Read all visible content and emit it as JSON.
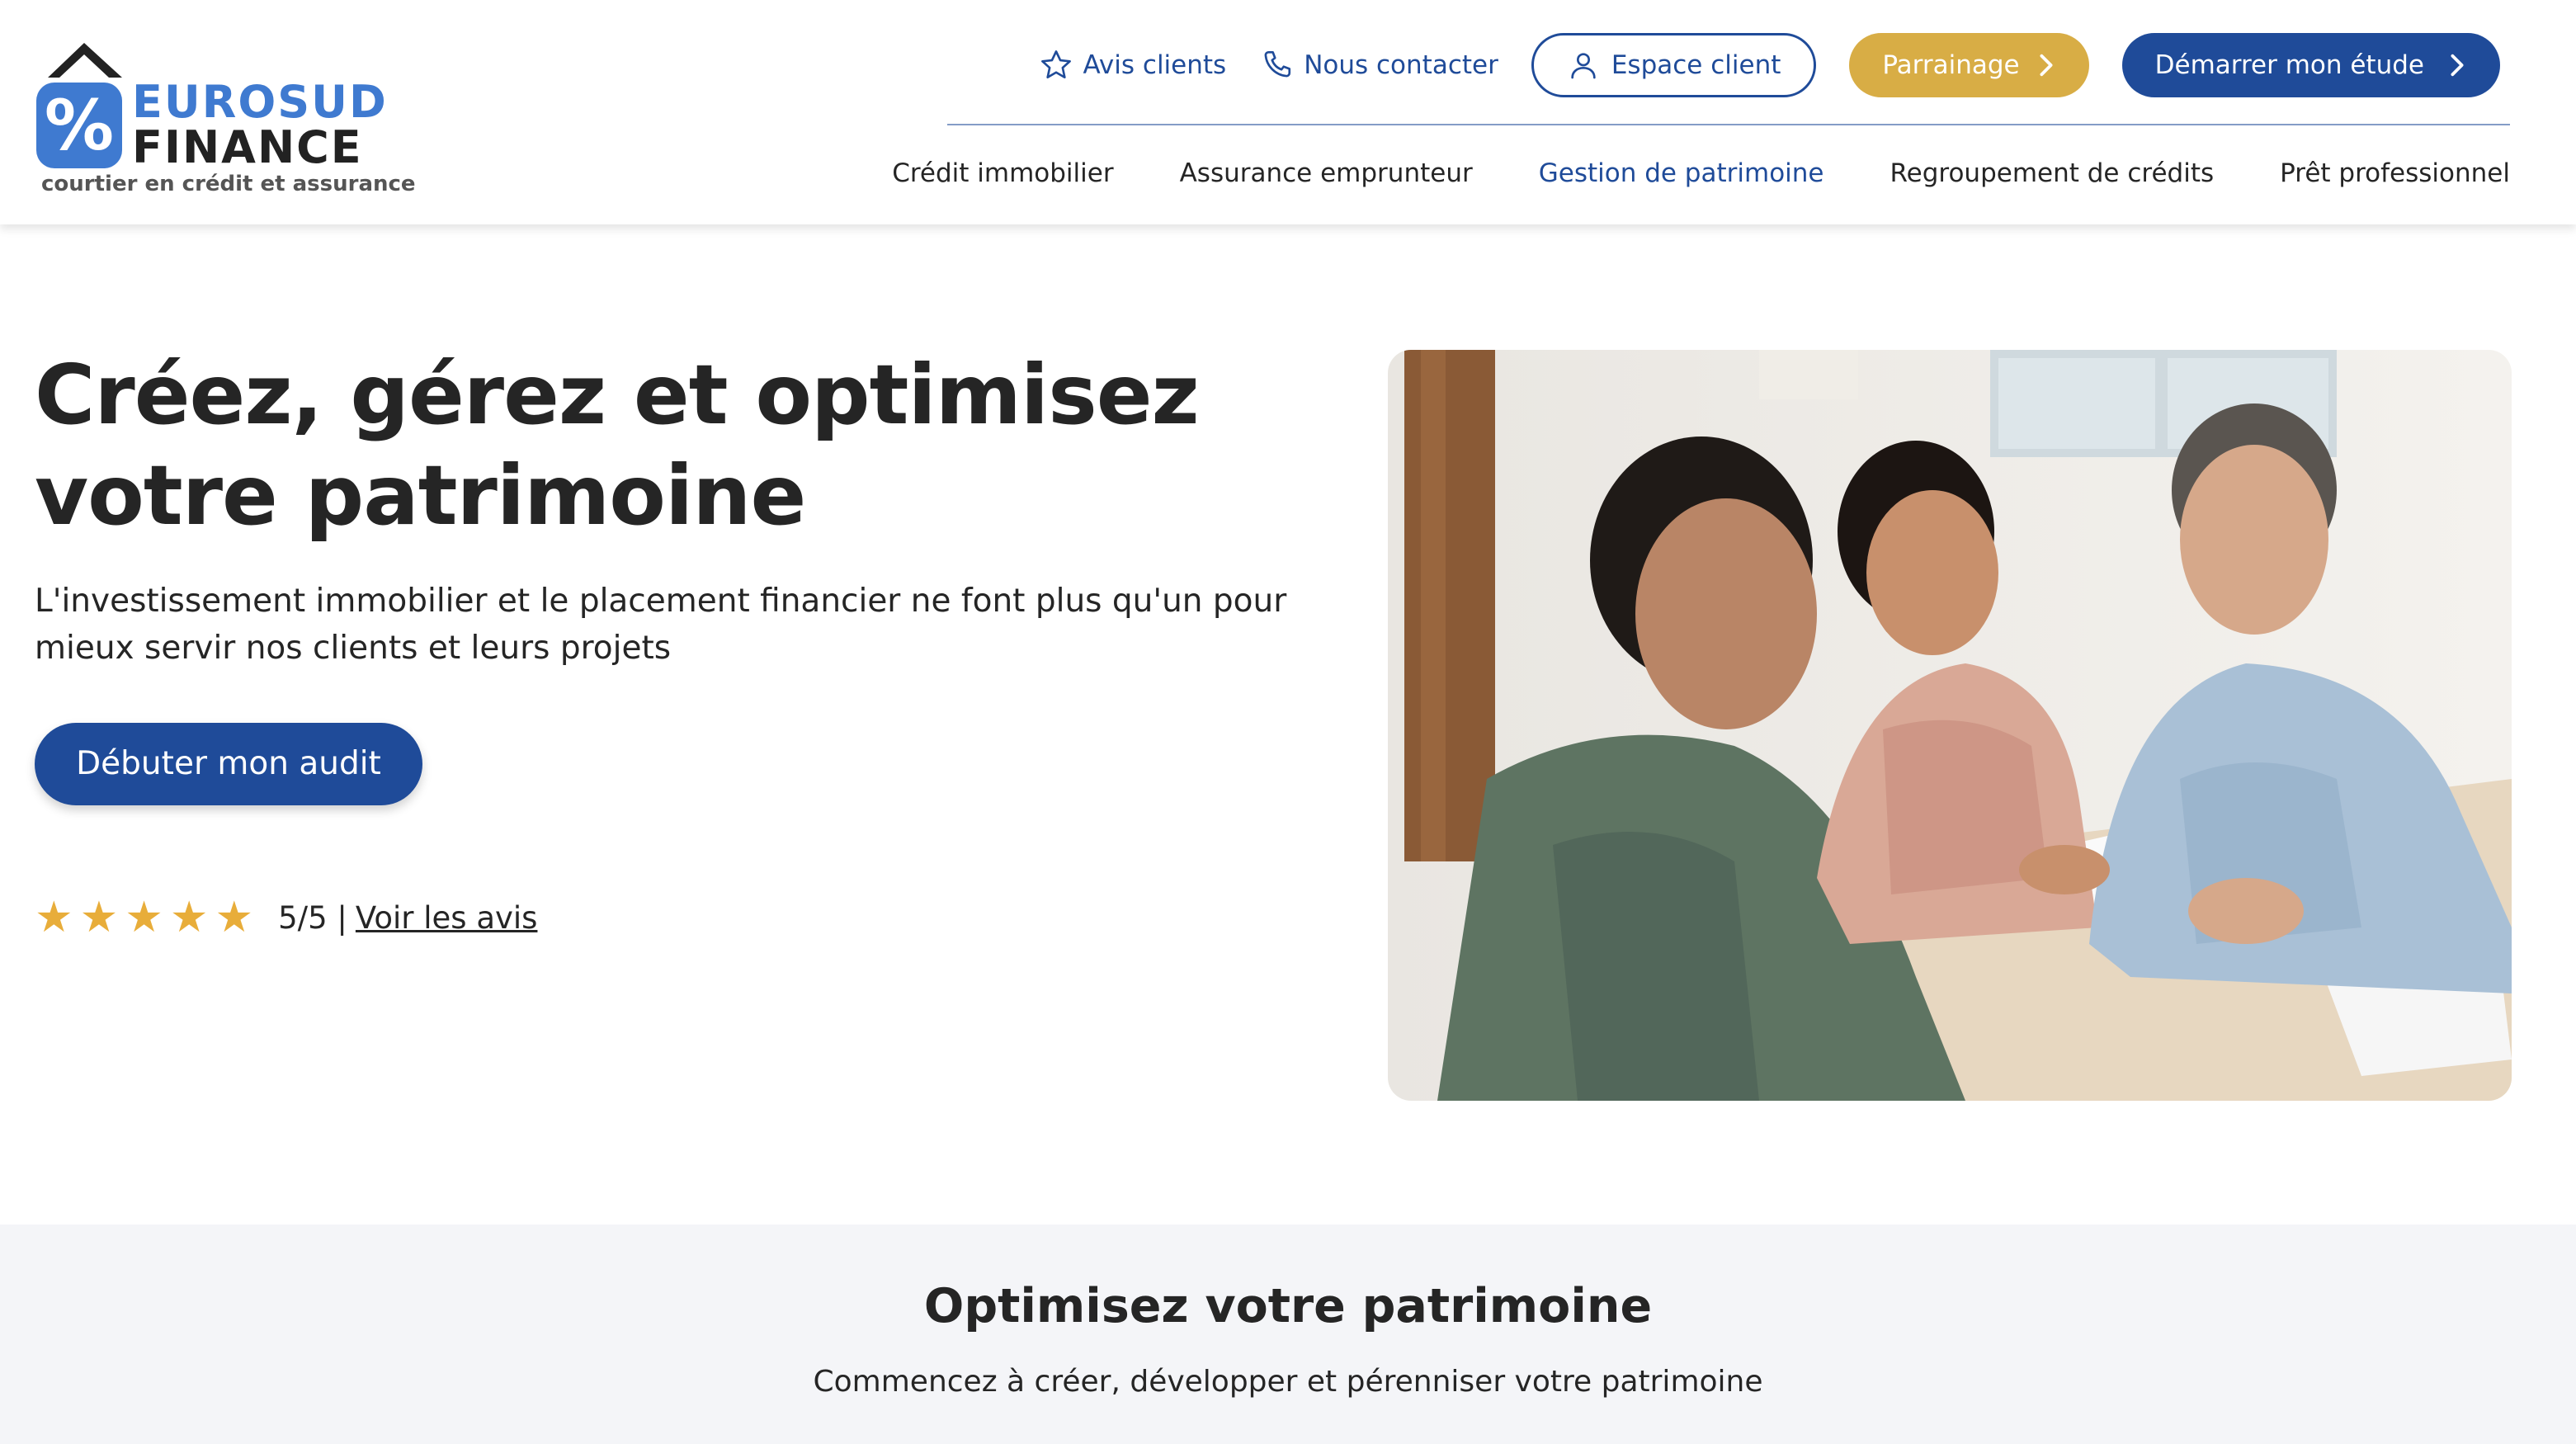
{
  "logo": {
    "badge_text": "%",
    "word1": "EUROSUD",
    "word2": "FINANCE",
    "tagline": "courtier en crédit et assurance"
  },
  "topbar": {
    "reviews_label": "Avis clients",
    "contact_label": "Nous contacter",
    "client_space_label": "Espace client",
    "referral_label": "Parrainage",
    "start_study_label": "Démarrer mon étude"
  },
  "nav": {
    "items": [
      {
        "label": "Crédit immobilier",
        "active": false
      },
      {
        "label": "Assurance emprunteur",
        "active": false
      },
      {
        "label": "Gestion de patrimoine",
        "active": true
      },
      {
        "label": "Regroupement de crédits",
        "active": false
      },
      {
        "label": "Prêt professionnel",
        "active": false
      }
    ]
  },
  "hero": {
    "title": "Créez, gérez et optimisez votre patrimoine",
    "subtitle": "L'investissement immobilier et le placement financier ne font plus qu'un pour mieux servir nos clients et leurs projets",
    "cta_label": "Débuter mon audit",
    "rating": {
      "stars": 5,
      "score_text": "5/5 |",
      "link_label": "Voir les avis"
    }
  },
  "section": {
    "title": "Optimisez votre patrimoine",
    "subtitle": "Commencez à créer, développer et pérenniser votre patrimoine"
  },
  "colors": {
    "brand_blue": "#1f4b99",
    "logo_blue": "#3f7ad0",
    "gold": "#d8ad45",
    "star": "#e8ad3a",
    "section_bg": "#f4f5f8"
  },
  "icons": [
    "star-outline-icon",
    "phone-icon",
    "user-icon",
    "chevron-right-icon",
    "star-icon"
  ]
}
